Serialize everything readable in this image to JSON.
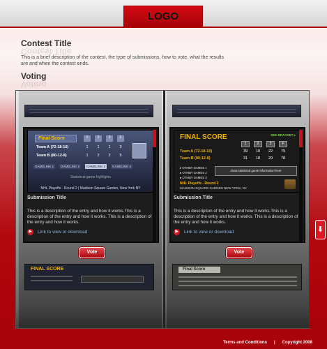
{
  "header": {
    "logo": "LOGO"
  },
  "contest": {
    "title": "Contest Title",
    "description": "This is a brief description of the contest, the type of submissions, how to vote, what the results are and when the contest ends."
  },
  "voting": {
    "title": "Voting"
  },
  "entries": [
    {
      "screenshot": {
        "heading": "Final Score",
        "col_headers": [
          "1",
          "2",
          "3",
          "F"
        ],
        "rows": [
          {
            "team": "Team A (72-18-10)",
            "scores": [
              "1",
              "1",
              "1",
              "3"
            ]
          },
          {
            "team": "Team B (80-12-8)",
            "scores": [
              "1",
              "2",
              "2",
              "5"
            ]
          }
        ],
        "links": [
          "GAMELINK 1",
          "GAMELINK 2",
          "GAMELINK 3",
          "GAMELINK 4"
        ],
        "highlights": "Statistical game highlights",
        "footer": "NHL Playoffs - Round 2 | Madison Square Garden, New York NY"
      },
      "submission_title": "Submission Title",
      "description": "This is a description of the entry and how it works.This is a description of the entry and how it works. This is a description of the entry and how it works.",
      "link": "Link to view or download",
      "vote": "Vote"
    },
    {
      "screenshot": {
        "heading": "FINAL SCORE",
        "see_bracket": "SEE BRACKET ▸",
        "col_headers": [
          "1",
          "2",
          "3",
          "F"
        ],
        "rows": [
          {
            "team": "Team A (72-18-10)",
            "scores": [
              "39",
              "18",
              "22",
              "79"
            ]
          },
          {
            "team": "Team B (80-12-8)",
            "scores": [
              "31",
              "18",
              "29",
              "78"
            ]
          }
        ],
        "other_games": [
          "▸ OTHER GAMES 1",
          "▸ OTHER GAMES 2",
          "▸ OTHER GAMES 3"
        ],
        "info_button": "show statistical game information here",
        "footer_line1": "NHL Playoffs - Round 2",
        "footer_line2": "MADISON SQUARE GARDEN NEW YORK, NY"
      },
      "submission_title": "Submission Title",
      "description": "This is a description of the entry and how it works.This is a description of the entry and how it works. This is a description of the entry and how it works.",
      "link": "Link to view or download",
      "vote": "Vote"
    }
  ],
  "bottom_thumbs": [
    {
      "heading": "FINAL SCORE"
    },
    {
      "heading": "Final Score"
    }
  ],
  "footer": {
    "terms": "Terms and Conditions",
    "separator": "|",
    "copyright": "Copyright 2008"
  },
  "colors": {
    "brand": "#a8020a",
    "accent": "#d51a22",
    "link": "#8fb3d9",
    "score_gold": "#f0b000"
  },
  "icons": {
    "scroll_down": "down-arrow-icon",
    "link": "right-arrow-icon"
  }
}
